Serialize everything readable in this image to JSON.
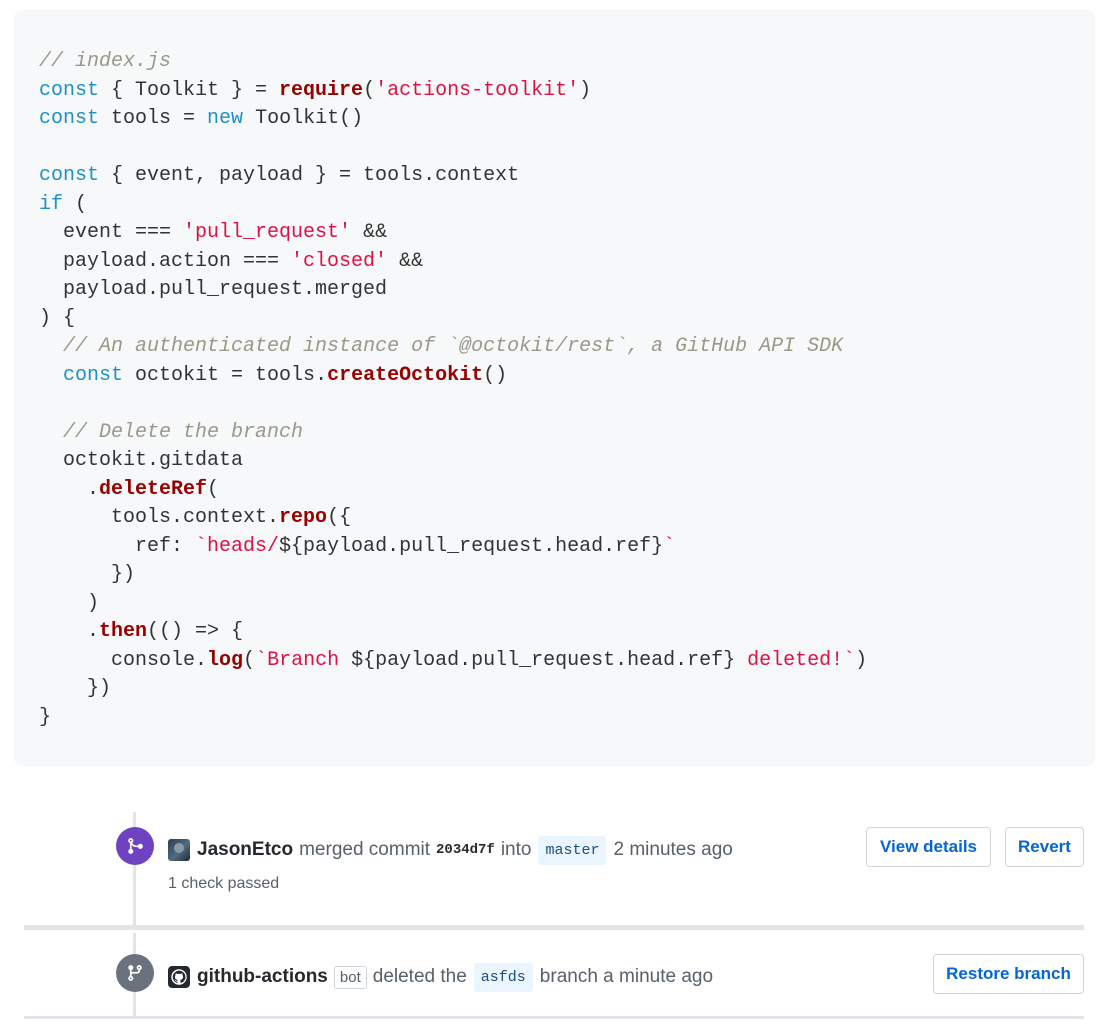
{
  "code": {
    "lines": [
      [
        {
          "t": "// index.js",
          "c": "comment"
        }
      ],
      [
        {
          "t": "const",
          "c": "keyword"
        },
        {
          "t": " { Toolkit } = "
        },
        {
          "t": "require",
          "c": "func"
        },
        {
          "t": "("
        },
        {
          "t": "'actions-toolkit'",
          "c": "string"
        },
        {
          "t": ")"
        }
      ],
      [
        {
          "t": "const",
          "c": "keyword"
        },
        {
          "t": " tools = "
        },
        {
          "t": "new",
          "c": "keyword"
        },
        {
          "t": " Toolkit()"
        }
      ],
      [],
      [
        {
          "t": "const",
          "c": "keyword"
        },
        {
          "t": " { event, payload } = tools.context"
        }
      ],
      [
        {
          "t": "if",
          "c": "keyword"
        },
        {
          "t": " ("
        }
      ],
      [
        {
          "t": "  event === "
        },
        {
          "t": "'pull_request'",
          "c": "string"
        },
        {
          "t": " &&"
        }
      ],
      [
        {
          "t": "  payload.action === "
        },
        {
          "t": "'closed'",
          "c": "string"
        },
        {
          "t": " &&"
        }
      ],
      [
        {
          "t": "  payload.pull_request.merged"
        }
      ],
      [
        {
          "t": ") {"
        }
      ],
      [
        {
          "t": "  "
        },
        {
          "t": "// An authenticated instance of `@octokit/rest`, a GitHub API SDK",
          "c": "comment"
        }
      ],
      [
        {
          "t": "  "
        },
        {
          "t": "const",
          "c": "keyword"
        },
        {
          "t": " octokit = tools."
        },
        {
          "t": "createOctokit",
          "c": "func"
        },
        {
          "t": "()"
        }
      ],
      [],
      [
        {
          "t": "  "
        },
        {
          "t": "// Delete the branch",
          "c": "comment"
        }
      ],
      [
        {
          "t": "  octokit.gitdata"
        }
      ],
      [
        {
          "t": "    ."
        },
        {
          "t": "deleteRef",
          "c": "func"
        },
        {
          "t": "("
        }
      ],
      [
        {
          "t": "      tools.context."
        },
        {
          "t": "repo",
          "c": "func"
        },
        {
          "t": "({"
        }
      ],
      [
        {
          "t": "        ref: "
        },
        {
          "t": "`heads/",
          "c": "string"
        },
        {
          "t": "${payload.pull_request.head.ref}"
        },
        {
          "t": "`",
          "c": "string"
        }
      ],
      [
        {
          "t": "      })"
        }
      ],
      [
        {
          "t": "    )"
        }
      ],
      [
        {
          "t": "    ."
        },
        {
          "t": "then",
          "c": "func"
        },
        {
          "t": "(() => {"
        }
      ],
      [
        {
          "t": "      console."
        },
        {
          "t": "log",
          "c": "func"
        },
        {
          "t": "("
        },
        {
          "t": "`Branch ",
          "c": "string"
        },
        {
          "t": "${payload.pull_request.head.ref}"
        },
        {
          "t": " deleted!`",
          "c": "string"
        },
        {
          "t": ")"
        }
      ],
      [
        {
          "t": "    })"
        }
      ],
      [
        {
          "t": "}"
        }
      ]
    ]
  },
  "timeline": {
    "merge_event": {
      "icon": "git-merge-icon",
      "badge_color": "#6f42c1",
      "author": "JasonEtco",
      "action": "merged commit",
      "commit_sha": "2034d7f",
      "into_text": "into",
      "branch": "master",
      "time": "2 minutes ago",
      "status": "1 check passed",
      "buttons": {
        "view_details": "View details",
        "revert": "Revert"
      }
    },
    "delete_event": {
      "icon": "git-branch-icon",
      "badge_color": "#6a737d",
      "author": "github-actions",
      "bot_label": "bot",
      "action": "deleted the",
      "branch": "asfds",
      "suffix": "branch a minute ago",
      "buttons": {
        "restore": "Restore branch"
      }
    }
  }
}
